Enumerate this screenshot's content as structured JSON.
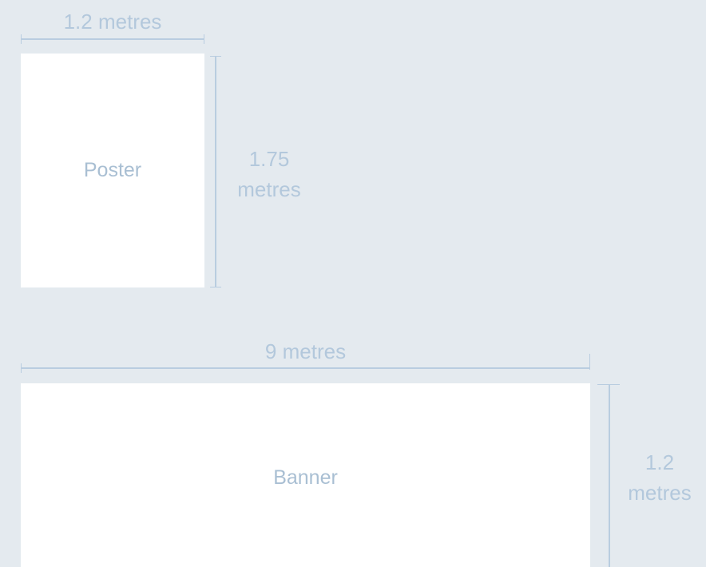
{
  "diagram": {
    "poster": {
      "label": "Poster",
      "width_label": "1.2 metres",
      "height_label_line1": "1.75",
      "height_label_line2": "metres"
    },
    "banner": {
      "label": "Banner",
      "width_label": "9 metres",
      "height_label_line1": "1.2",
      "height_label_line2": "metres"
    },
    "colors": {
      "background": "#e4eaef",
      "shape_fill": "#ffffff",
      "dimension_line": "#b9cde0",
      "text": "#b3c8dc"
    }
  }
}
